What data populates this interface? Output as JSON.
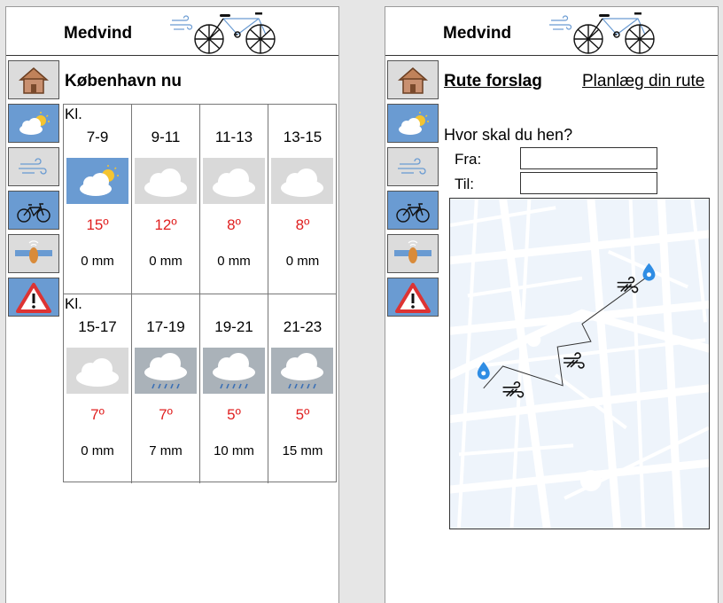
{
  "left_screen": {
    "header": {
      "title": "Medvind",
      "logo_icon": "bicycle-with-wind-logo"
    },
    "nav": [
      {
        "icon": "house-icon",
        "active": false
      },
      {
        "icon": "cloud-sun-icon",
        "active": true
      },
      {
        "icon": "wind-icon",
        "active": false
      },
      {
        "icon": "bicycle-icon",
        "active": true
      },
      {
        "icon": "wind-sock-icon",
        "active": false
      },
      {
        "icon": "warning-triangle-icon",
        "active": true
      }
    ],
    "heading": "København nu",
    "forecast": {
      "kl_label": "Kl.",
      "slots": [
        {
          "time": "7-9",
          "icon": "partly-sunny",
          "temp": "15º",
          "precip": "0 mm"
        },
        {
          "time": "9-11",
          "icon": "cloudy",
          "temp": "12º",
          "precip": "0 mm"
        },
        {
          "time": "11-13",
          "icon": "cloudy",
          "temp": "8º",
          "precip": "0 mm"
        },
        {
          "time": "13-15",
          "icon": "cloudy",
          "temp": "8º",
          "precip": "0 mm"
        },
        {
          "time": "15-17",
          "icon": "cloudy",
          "temp": "7º",
          "precip": "0 mm"
        },
        {
          "time": "17-19",
          "icon": "rain",
          "temp": "7º",
          "precip": "7 mm"
        },
        {
          "time": "19-21",
          "icon": "rain",
          "temp": "5º",
          "precip": "10 mm"
        },
        {
          "time": "21-23",
          "icon": "rain",
          "temp": "5º",
          "precip": "15 mm"
        }
      ]
    }
  },
  "right_screen": {
    "header": {
      "title": "Medvind",
      "logo_icon": "bicycle-with-wind-logo"
    },
    "nav": [
      {
        "icon": "house-icon",
        "active": false
      },
      {
        "icon": "cloud-sun-icon",
        "active": true
      },
      {
        "icon": "wind-icon",
        "active": false
      },
      {
        "icon": "bicycle-icon",
        "active": true
      },
      {
        "icon": "wind-sock-icon",
        "active": false
      },
      {
        "icon": "warning-triangle-icon",
        "active": true
      }
    ],
    "route_title": "Rute forslag",
    "plan_link": "Planlæg din rute",
    "question": "Hvor skal du hen?",
    "from_label": "Fra:",
    "from_value": "",
    "to_label": "Til:",
    "to_value": "",
    "map": {
      "icon": "street-map-with-route",
      "markers": [
        "start-pin-icon",
        "end-pin-icon"
      ],
      "wind_markers": 3
    }
  },
  "colors": {
    "active_nav": "#6a9bd2",
    "inactive_nav": "#dcdcdc",
    "temperature": "#e02020",
    "cloudy_bg": "#d9d9d9",
    "rain_bg": "#aab2b9",
    "pin": "#2f8de4"
  }
}
